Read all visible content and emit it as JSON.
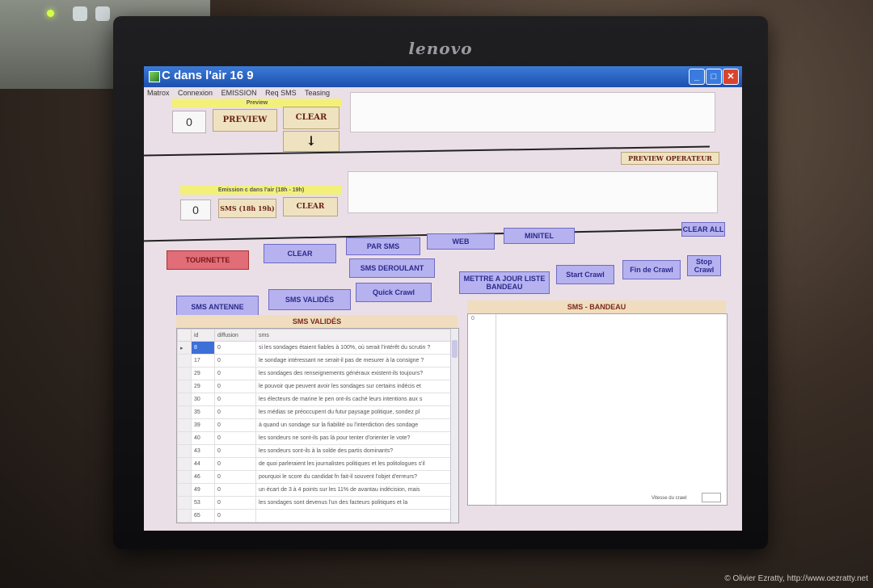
{
  "window": {
    "title": "C dans l'air 16 9"
  },
  "menu": [
    "Matrox",
    "Connexion",
    "EMISSION",
    "Req SMS",
    "Teasing"
  ],
  "preview": {
    "label": "Preview",
    "count": "0",
    "preview_btn": "PREVIEW",
    "clear_btn": "CLEAR",
    "down_arrow": "↓",
    "operateur_btn": "PREVIEW OPERATEUR"
  },
  "emission": {
    "label": "Emission c dans l'air (18h - 19h)",
    "count": "0",
    "sms_btn": "SMS (18h 19h)",
    "clear_btn": "CLEAR"
  },
  "buttons": {
    "tournette": "TOURNETTE",
    "clear": "CLEAR",
    "par_sms": "PAR SMS",
    "web": "WEB",
    "minitel": "MINITEL",
    "clear_all": "CLEAR ALL",
    "sms_deroulant": "SMS DEROULANT",
    "quick_crawl": "Quick Crawl",
    "sms_antenne": "SMS ANTENNE",
    "sms_valides": "SMS VALIDÉS",
    "mettre_a_jour": "METTRE A JOUR LISTE BANDEAU",
    "start_crawl": "Start Crawl",
    "fin_crawl": "Fin de Crawl",
    "stop_crawl": "Stop Crawl"
  },
  "valides_panel": {
    "header": "SMS VALIDÉS",
    "columns": [
      "id",
      "diffusion",
      "sms"
    ],
    "rows": [
      {
        "id": "8",
        "diffusion": "0",
        "sms": "si les sondages étaient fiables à 100%, où serait l'intérêt du scrutin ?"
      },
      {
        "id": "17",
        "diffusion": "0",
        "sms": "le sondage intéressant ne serait-il pas de mesurer à la consigne ?"
      },
      {
        "id": "29",
        "diffusion": "0",
        "sms": "les sondages des renseignements généraux existent-ils toujours?"
      },
      {
        "id": "29",
        "diffusion": "0",
        "sms": "le pouvoir que peuvent avoir les sondages sur certains indécis et"
      },
      {
        "id": "30",
        "diffusion": "0",
        "sms": "les électeurs de marine le pen ont-ils caché leurs intentions aux s"
      },
      {
        "id": "35",
        "diffusion": "0",
        "sms": "les médias se préoccupent du futur paysage politique, sondez pl"
      },
      {
        "id": "39",
        "diffusion": "0",
        "sms": "à quand un sondage sur la fiabilité ou l'interdiction des sondage"
      },
      {
        "id": "40",
        "diffusion": "0",
        "sms": "les sondeurs ne sont-ils pas là pour tenter d'orienter le vote?"
      },
      {
        "id": "43",
        "diffusion": "0",
        "sms": "les sondeurs sont-ils à la solde des partis dominants?"
      },
      {
        "id": "44",
        "diffusion": "0",
        "sms": "de quoi parleraient les journalistes politiques et les politologues s'il"
      },
      {
        "id": "46",
        "diffusion": "0",
        "sms": "pourquoi le score du candidat fn fait-il souvent l'objet d'erreurs?"
      },
      {
        "id": "49",
        "diffusion": "0",
        "sms": "un écart de 3 à 4 points sur les 11% de avantau indécision, mais"
      },
      {
        "id": "53",
        "diffusion": "0",
        "sms": "les sondages sont devenus l'un des facteurs politiques et la"
      },
      {
        "id": "65",
        "diffusion": "0",
        "sms": ""
      }
    ]
  },
  "bandeau_panel": {
    "header": "SMS - BANDEAU",
    "col0": "0"
  },
  "crawl": {
    "label": "Vitesse du crawl"
  },
  "watermark": "© Olivier Ezratty, http://www.oezratty.net"
}
